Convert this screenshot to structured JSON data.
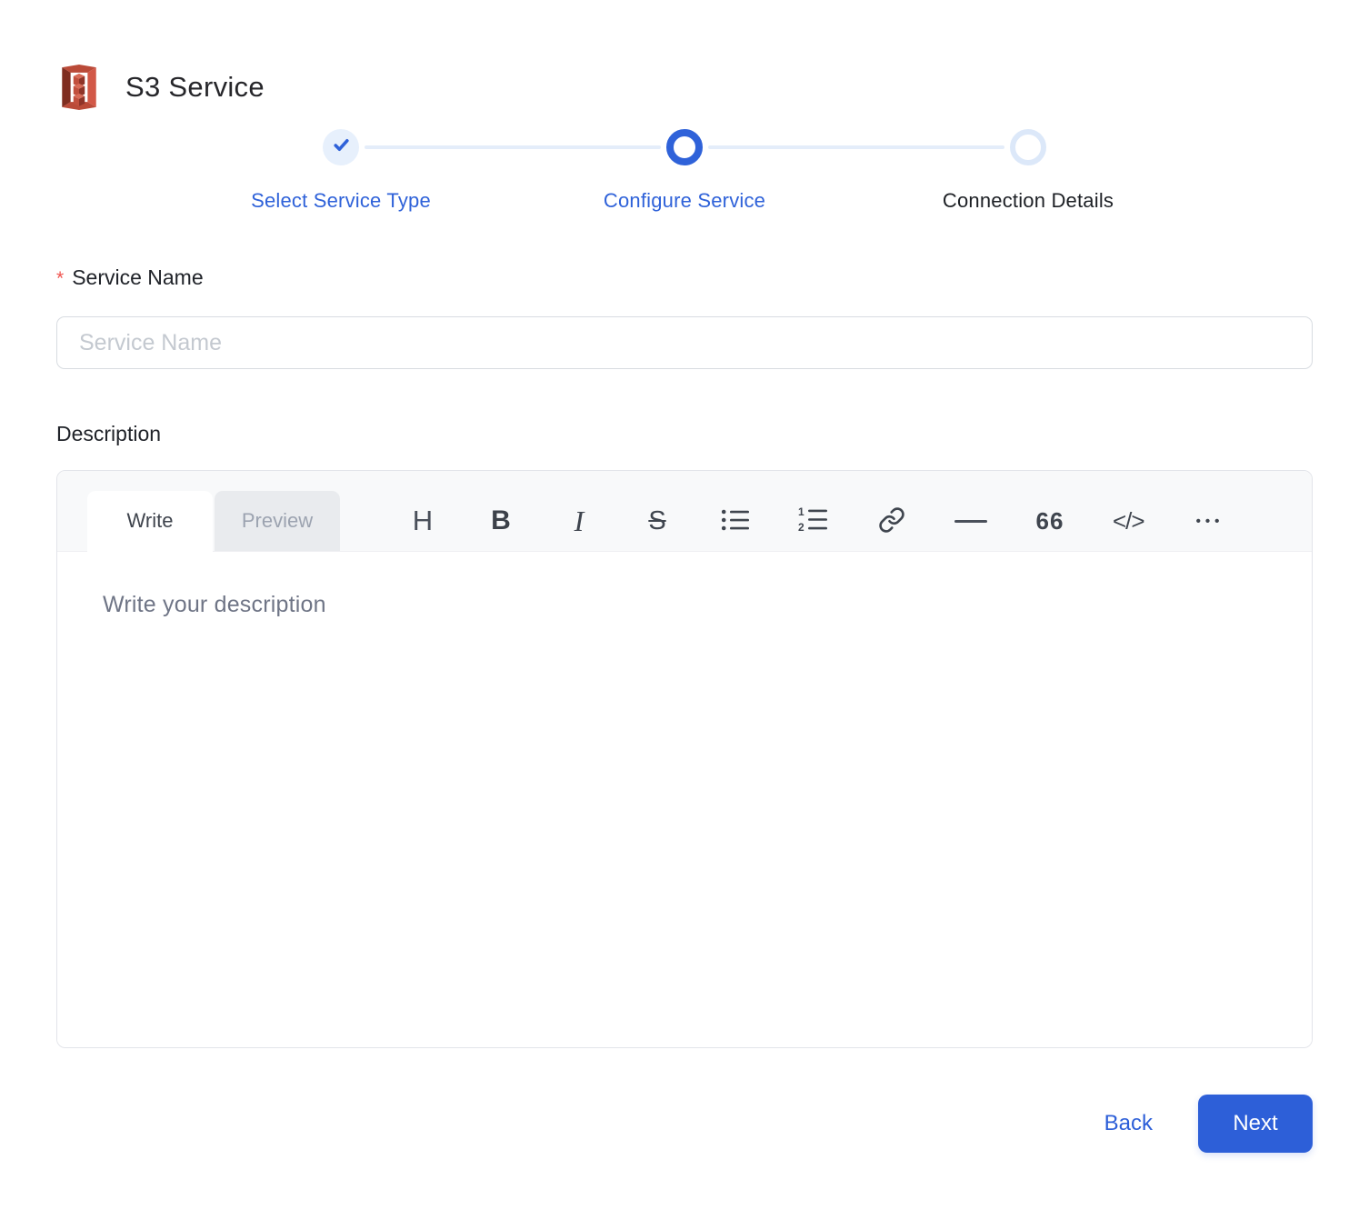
{
  "header": {
    "title": "S3 Service",
    "icon": "s3-service-icon"
  },
  "stepper": {
    "steps": [
      {
        "label": "Select Service Type",
        "state": "completed"
      },
      {
        "label": "Configure Service",
        "state": "active"
      },
      {
        "label": "Connection Details",
        "state": "pending"
      }
    ]
  },
  "form": {
    "service_name": {
      "label": "Service Name",
      "required_marker": "*",
      "placeholder": "Service Name",
      "value": ""
    },
    "description": {
      "label": "Description"
    }
  },
  "editor": {
    "tabs": [
      {
        "label": "Write",
        "active": true
      },
      {
        "label": "Preview",
        "active": false
      }
    ],
    "toolbar_icons": [
      "heading-icon",
      "bold-icon",
      "italic-icon",
      "strikethrough-icon",
      "unordered-list-icon",
      "ordered-list-icon",
      "link-icon",
      "horizontal-rule-icon",
      "quote-icon",
      "code-icon",
      "more-icon"
    ],
    "toolbar_glyphs": {
      "heading": "H",
      "bold": "B",
      "italic": "I",
      "strikethrough": "S",
      "quote": "66",
      "code": "</>",
      "more": "•••"
    },
    "placeholder": "Write your description",
    "value": ""
  },
  "footer": {
    "back_label": "Back",
    "next_label": "Next"
  },
  "colors": {
    "primary_blue": "#2D5FD8",
    "step_done_bg": "#E7F0FC",
    "step_pending_ring": "#DCE8F9",
    "required_red": "#F0544F",
    "s3_red_dark": "#7F2D20",
    "s3_red_mid": "#BA4A38",
    "s3_red_light": "#D25847",
    "toolbar_bg": "#F8F9FA"
  }
}
